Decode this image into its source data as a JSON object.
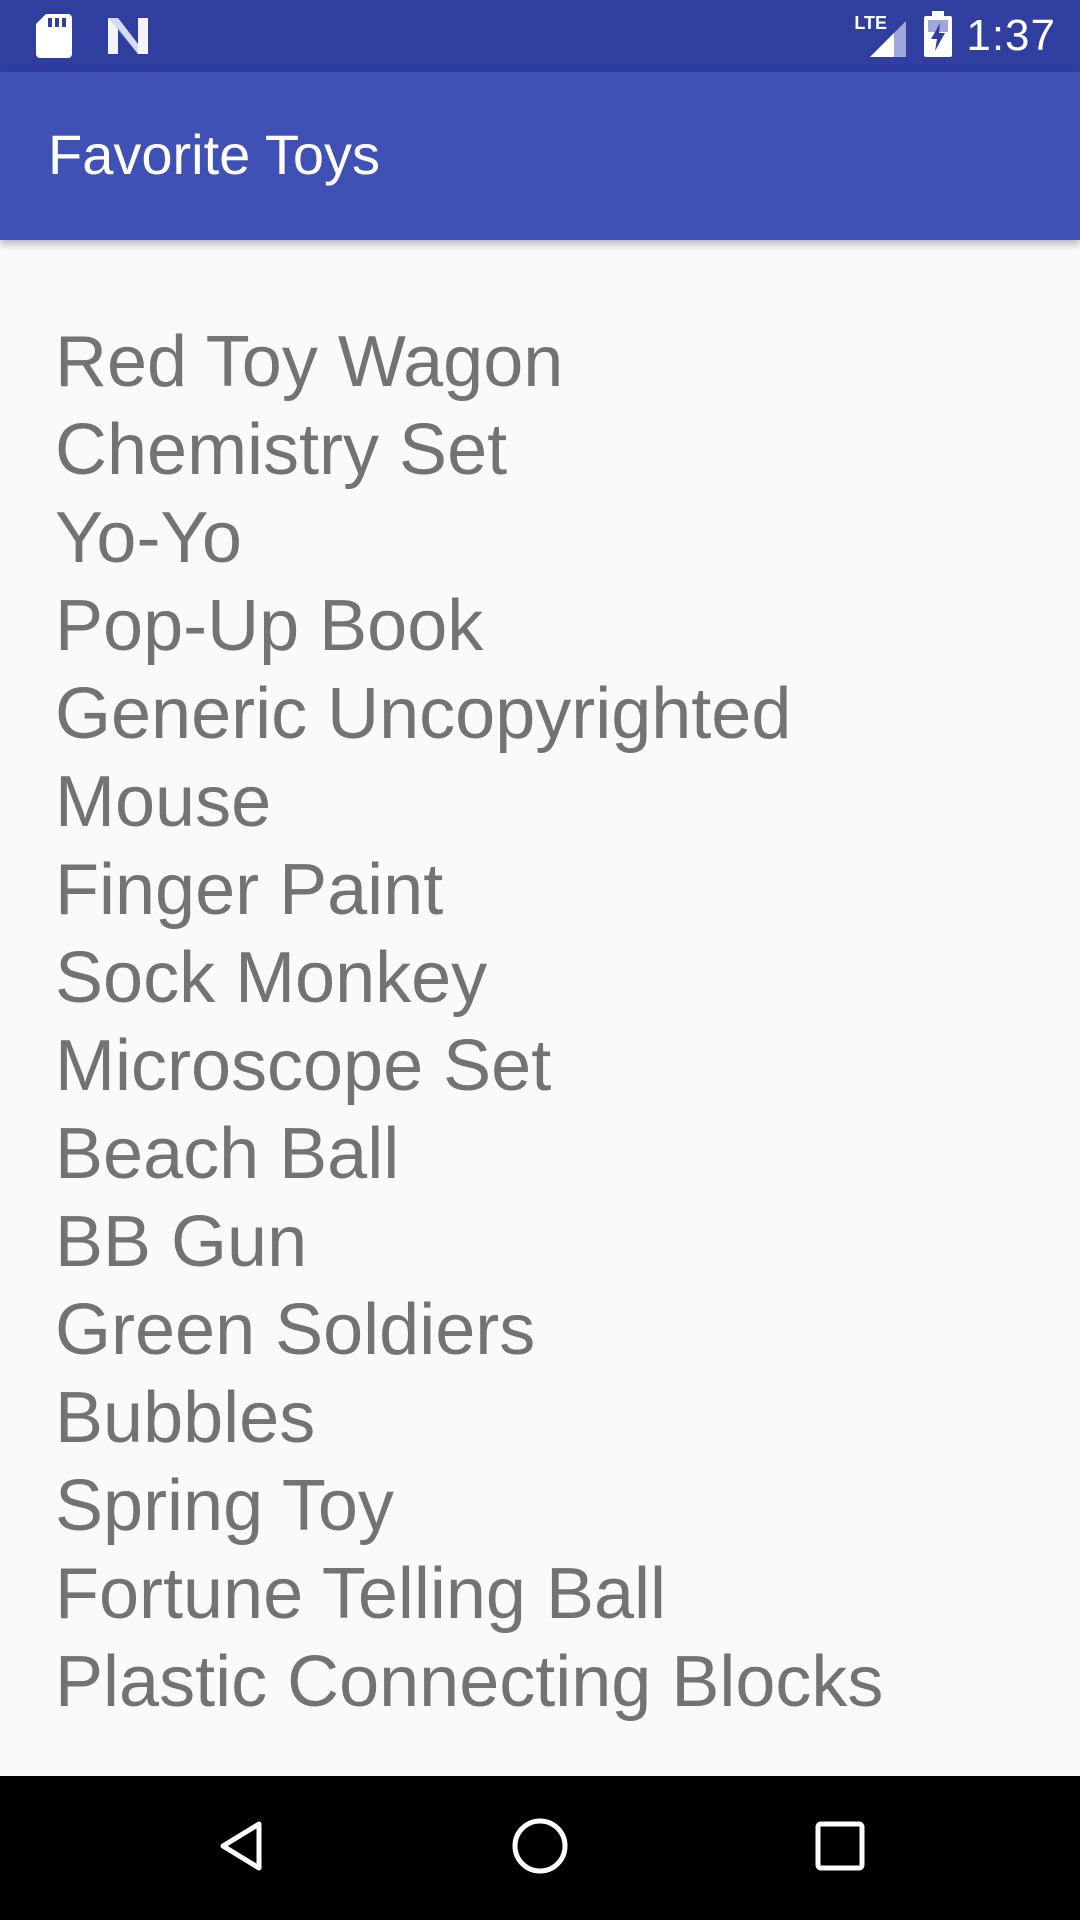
{
  "status_bar": {
    "time": "1:37",
    "network_label": "LTE",
    "icons": [
      "sd-card-icon",
      "notification-n-icon",
      "lte-signal-icon",
      "battery-charging-icon"
    ],
    "background_color": "#303f9f"
  },
  "app_bar": {
    "title": "Favorite Toys",
    "background_color": "#3f51b5"
  },
  "toys": [
    "Red Toy Wagon",
    "Chemistry Set",
    "Yo-Yo",
    "Pop-Up Book",
    "Generic Uncopyrighted Mouse",
    "Finger Paint",
    "Sock Monkey",
    "Microscope Set",
    "Beach Ball",
    "BB Gun",
    "Green Soldiers",
    "Bubbles",
    "Spring Toy",
    "Fortune Telling Ball",
    "Plastic Connecting Blocks"
  ],
  "navigation_bar": {
    "buttons": [
      "back-icon",
      "home-icon",
      "recent-apps-icon"
    ]
  }
}
